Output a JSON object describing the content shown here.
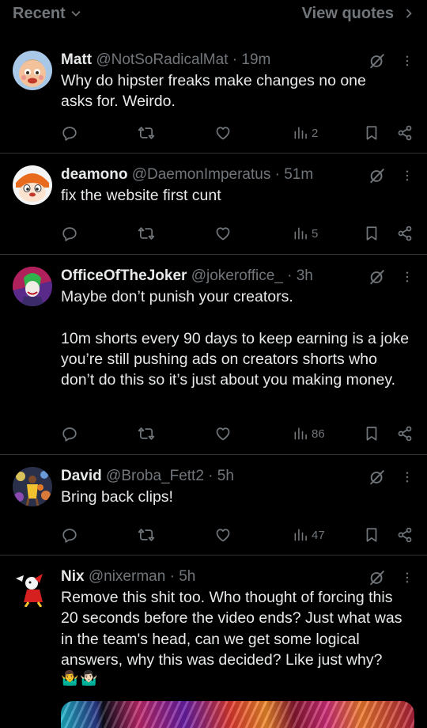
{
  "header": {
    "left_label": "Recent",
    "right_label": "View quotes"
  },
  "colors": {
    "background": "#000000",
    "text": "#e7e9ea",
    "secondary": "#71767b",
    "divider": "#2f3336"
  },
  "tweets": [
    {
      "name": "Matt",
      "handle": "@NotSoRadicalMat",
      "sep": " · ",
      "time": "19m",
      "text": "Why do hipster freaks make changes no one asks for. Weirdo.",
      "views": "2"
    },
    {
      "name": "deamono",
      "handle": "@DaemonImperatus",
      "sep": " · ",
      "time": "51m",
      "text": "fix the website first cunt",
      "views": "5"
    },
    {
      "name": "OfficeOfTheJoker",
      "handle": "@jokeroffice_",
      "sep": " · ",
      "time": "3h",
      "text": "Maybe don’t punish your creators.\n\n10m shorts every 90 days to keep earning is a joke you’re still pushing ads on creators shorts who don’t do this so it’s just about you making money.",
      "views": "86"
    },
    {
      "name": "David",
      "handle": "@Broba_Fett2",
      "sep": " · ",
      "time": "5h",
      "text": "Bring back clips!",
      "views": "47"
    },
    {
      "name": "Nix",
      "handle": "@nixerman",
      "sep": " · ",
      "time": "5h",
      "text": "Remove this shit too. Who thought of forcing this 20 seconds before the video ends? Just what was in the team's head, can we get some logical answers, why this was decided? Like just why?",
      "emoji": "🤷‍♂️🤷🏻‍♂️"
    }
  ],
  "icons": {
    "reply": "reply-icon",
    "retweet": "retweet-icon",
    "like": "heart-icon",
    "views": "views-icon",
    "bookmark": "bookmark-icon",
    "share": "share-icon",
    "grok": "grok-icon",
    "more": "more-icon"
  }
}
